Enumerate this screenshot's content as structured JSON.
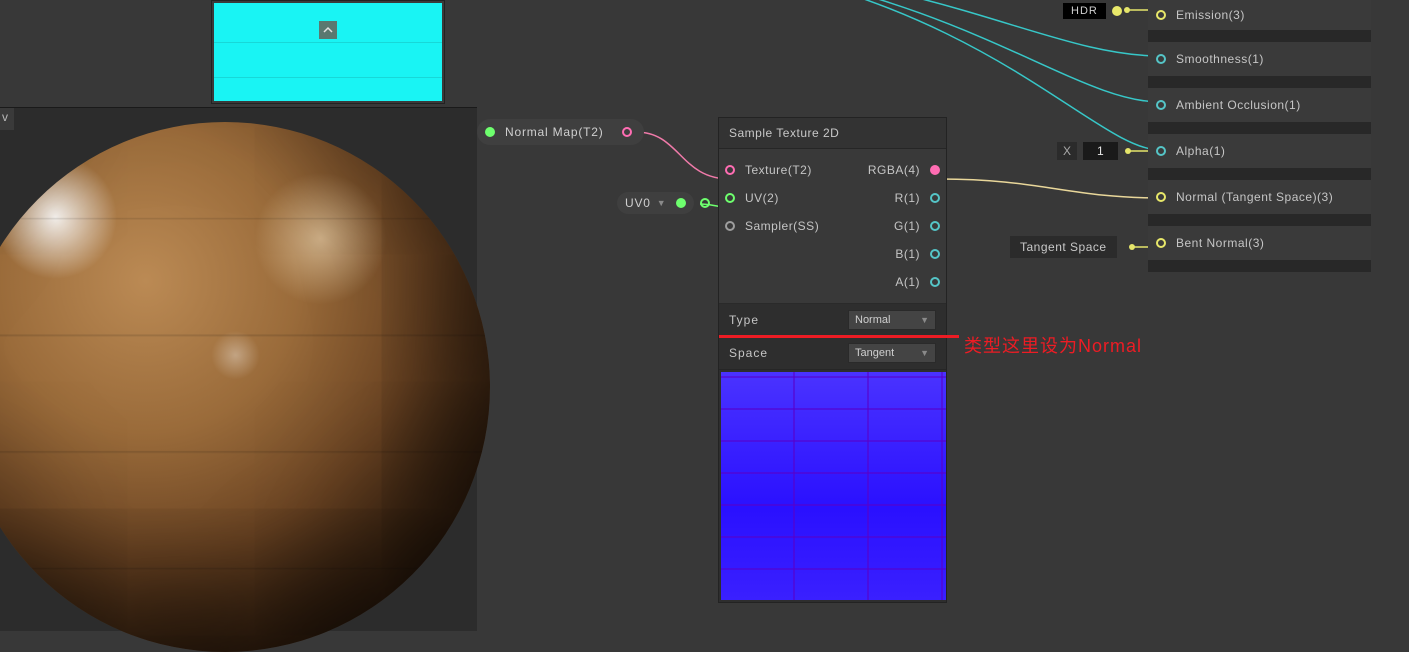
{
  "top_preview": {
    "badge_icon": "chevron-up"
  },
  "sphere_panel": {
    "tab": "v"
  },
  "normal_map_pill": {
    "label": "Normal Map(T2)"
  },
  "uv0_pill": {
    "label": "UV0"
  },
  "node": {
    "title": "Sample Texture 2D",
    "inputs": {
      "texture": "Texture(T2)",
      "uv": "UV(2)",
      "sampler": "Sampler(SS)"
    },
    "outputs": {
      "rgba": "RGBA(4)",
      "r": "R(1)",
      "g": "G(1)",
      "b": "B(1)",
      "a": "A(1)"
    },
    "props": {
      "type_label": "Type",
      "type_value": "Normal",
      "space_label": "Space",
      "space_value": "Tangent"
    }
  },
  "annotation": "类型这里设为Normal",
  "master": {
    "emission": "Emission(3)",
    "smoothness": "Smoothness(1)",
    "ao": "Ambient Occlusion(1)",
    "alpha": "Alpha(1)",
    "normal": "Normal (Tangent Space)(3)",
    "bent": "Bent Normal(3)"
  },
  "widgets": {
    "hdr": "HDR",
    "x_label": "X",
    "x_value": "1",
    "tangent_space": "Tangent Space"
  }
}
